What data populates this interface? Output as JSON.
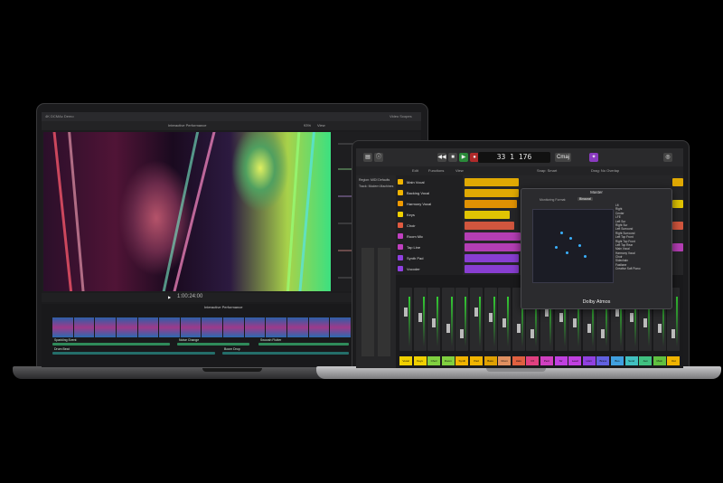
{
  "left_laptop": {
    "app": "Final Cut Pro",
    "project_name": "Interactive Performance",
    "top_left_label": "4K DCMAc Demo",
    "zoom": "93%",
    "view_label": "View",
    "timecode": "1:00:24:00",
    "timeline_title": "Interactive Performance",
    "inspector_label": "Video Scopes",
    "track_labels": [
      "Sparkling Event",
      "Noise Change",
      "Swoosh Flutter",
      "Drum Beat",
      "Boom Drop"
    ]
  },
  "right_laptop": {
    "app": "Logic Pro",
    "lcd": "33  1  176",
    "lcd_key": "Cmaj",
    "subbar": [
      "Edit",
      "Functions",
      "View",
      "Snap: Smart",
      "Drag: No Overlap"
    ],
    "inspector_title": "Region: MIDI Defaults",
    "track_header": "Track: Modern Machines",
    "tracks": [
      {
        "name": "Main Vocal",
        "color": "#f0b400"
      },
      {
        "name": "Backing Vocal",
        "color": "#f0b400"
      },
      {
        "name": "Harmony Vocal",
        "color": "#f09a00"
      },
      {
        "name": "Keys",
        "color": "#f0d000"
      },
      {
        "name": "Choir",
        "color": "#e05a40"
      },
      {
        "name": "Room Mic",
        "color": "#c040c0"
      },
      {
        "name": "Tap Line",
        "color": "#c040c0"
      },
      {
        "name": "Synth Pad",
        "color": "#9040e0"
      },
      {
        "name": "Vocoder",
        "color": "#9040e0"
      }
    ],
    "dolby": {
      "window_title": "Master",
      "monitoring_label": "Monitoring Format:",
      "monitoring_value": "Binaural",
      "footer": "Dolby Atmos",
      "objects": [
        "Lft",
        "Right",
        "Center",
        "LFE",
        "Left Sur",
        "Right Sur",
        "Left Surround",
        "Right Surround",
        "Left Top Front",
        "Right Top Front",
        "Left Top Rear",
        "Main Vocal",
        "Harmony Vocal",
        "Choir",
        "Sidechain",
        "Fastlane",
        "Creative Soft Piano"
      ]
    },
    "mixer_names": [
      "Vocal",
      "Keys",
      "Choir",
      "Room",
      "Synth",
      "Pad",
      "Bass",
      "Drum",
      "Hats",
      "FX",
      "Perc",
      "Str",
      "Lead",
      "Horn",
      "Brass",
      "Bus",
      "Send",
      "Aux",
      "Main",
      "Out"
    ],
    "mixer_colors": [
      "#f0d000",
      "#f0d000",
      "#80d040",
      "#80d040",
      "#f0b400",
      "#f0b400",
      "#e0a000",
      "#e09060",
      "#e06040",
      "#e04080",
      "#d040c0",
      "#c040e0",
      "#c040e0",
      "#9040e0",
      "#6060e0",
      "#40a0e0",
      "#40c0c0",
      "#40c080",
      "#60c040",
      "#f0b400"
    ]
  }
}
